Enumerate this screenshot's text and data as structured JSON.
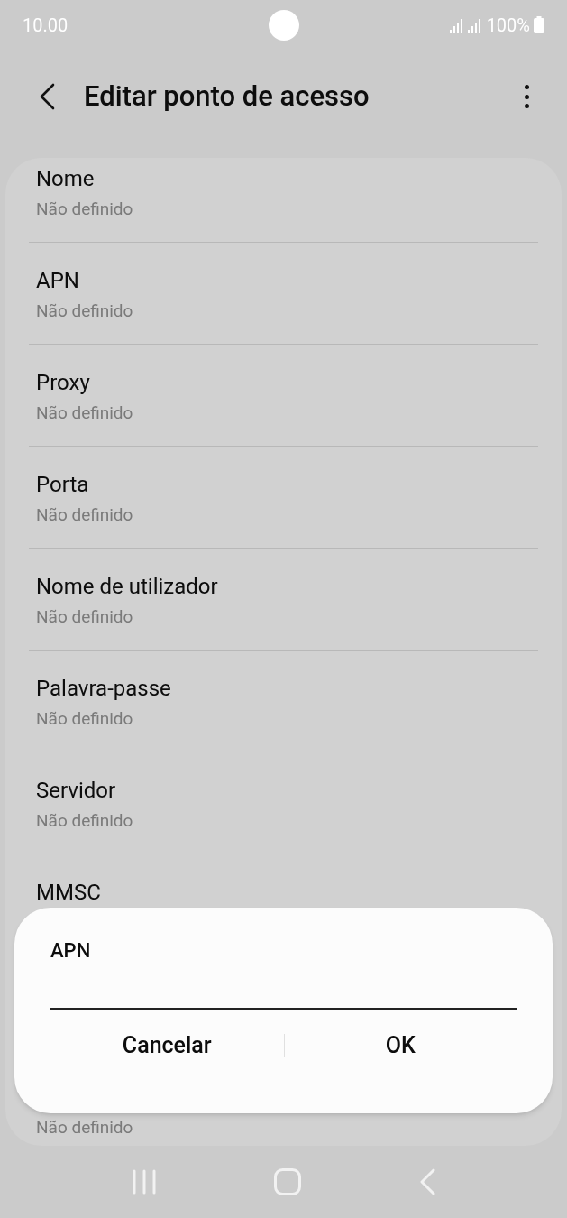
{
  "status_bar": {
    "time": "10.00",
    "battery": "100%"
  },
  "header": {
    "title": "Editar ponto de acesso"
  },
  "settings": [
    {
      "title": "Nome",
      "value": "Não definido"
    },
    {
      "title": "APN",
      "value": "Não definido"
    },
    {
      "title": "Proxy",
      "value": "Não definido"
    },
    {
      "title": "Porta",
      "value": "Não definido"
    },
    {
      "title": "Nome de utilizador",
      "value": "Não definido"
    },
    {
      "title": "Palavra-passe",
      "value": "Não definido"
    },
    {
      "title": "Servidor",
      "value": "Não definido"
    },
    {
      "title": "MMSC"
    }
  ],
  "trailing_value": "Não definido",
  "dialog": {
    "title": "APN",
    "buttons": [
      "Cancelar",
      "OK"
    ]
  }
}
